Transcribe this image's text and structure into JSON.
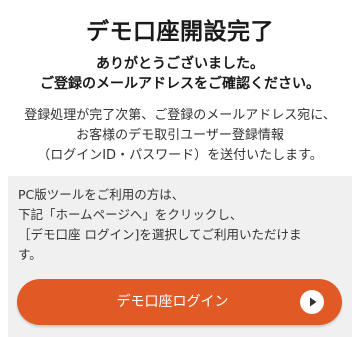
{
  "header": {
    "title": "デモ口座開設完了"
  },
  "thanks": {
    "line1": "ありがとうございました。",
    "line2": "ご登録のメールアドレスをご確認ください。"
  },
  "info": {
    "line1": "登録処理が完了次第、ご登録のメールアドレス宛に、",
    "line2": "お客様のデモ取引ユーザー登録情報",
    "line3": "（ログインID・パスワード）を送付いたします。"
  },
  "pc_panel": {
    "line1": "PC版ツールをご利用の方は、",
    "line2": "下記「ホームページへ」をクリックし、",
    "line3": "［デモ口座 ログイン]を選択してご利用いただけま",
    "line4": "す。",
    "button_label": "デモ口座ログイン",
    "button_icon": "play-circle-icon",
    "accent_color": "#e15a26"
  }
}
